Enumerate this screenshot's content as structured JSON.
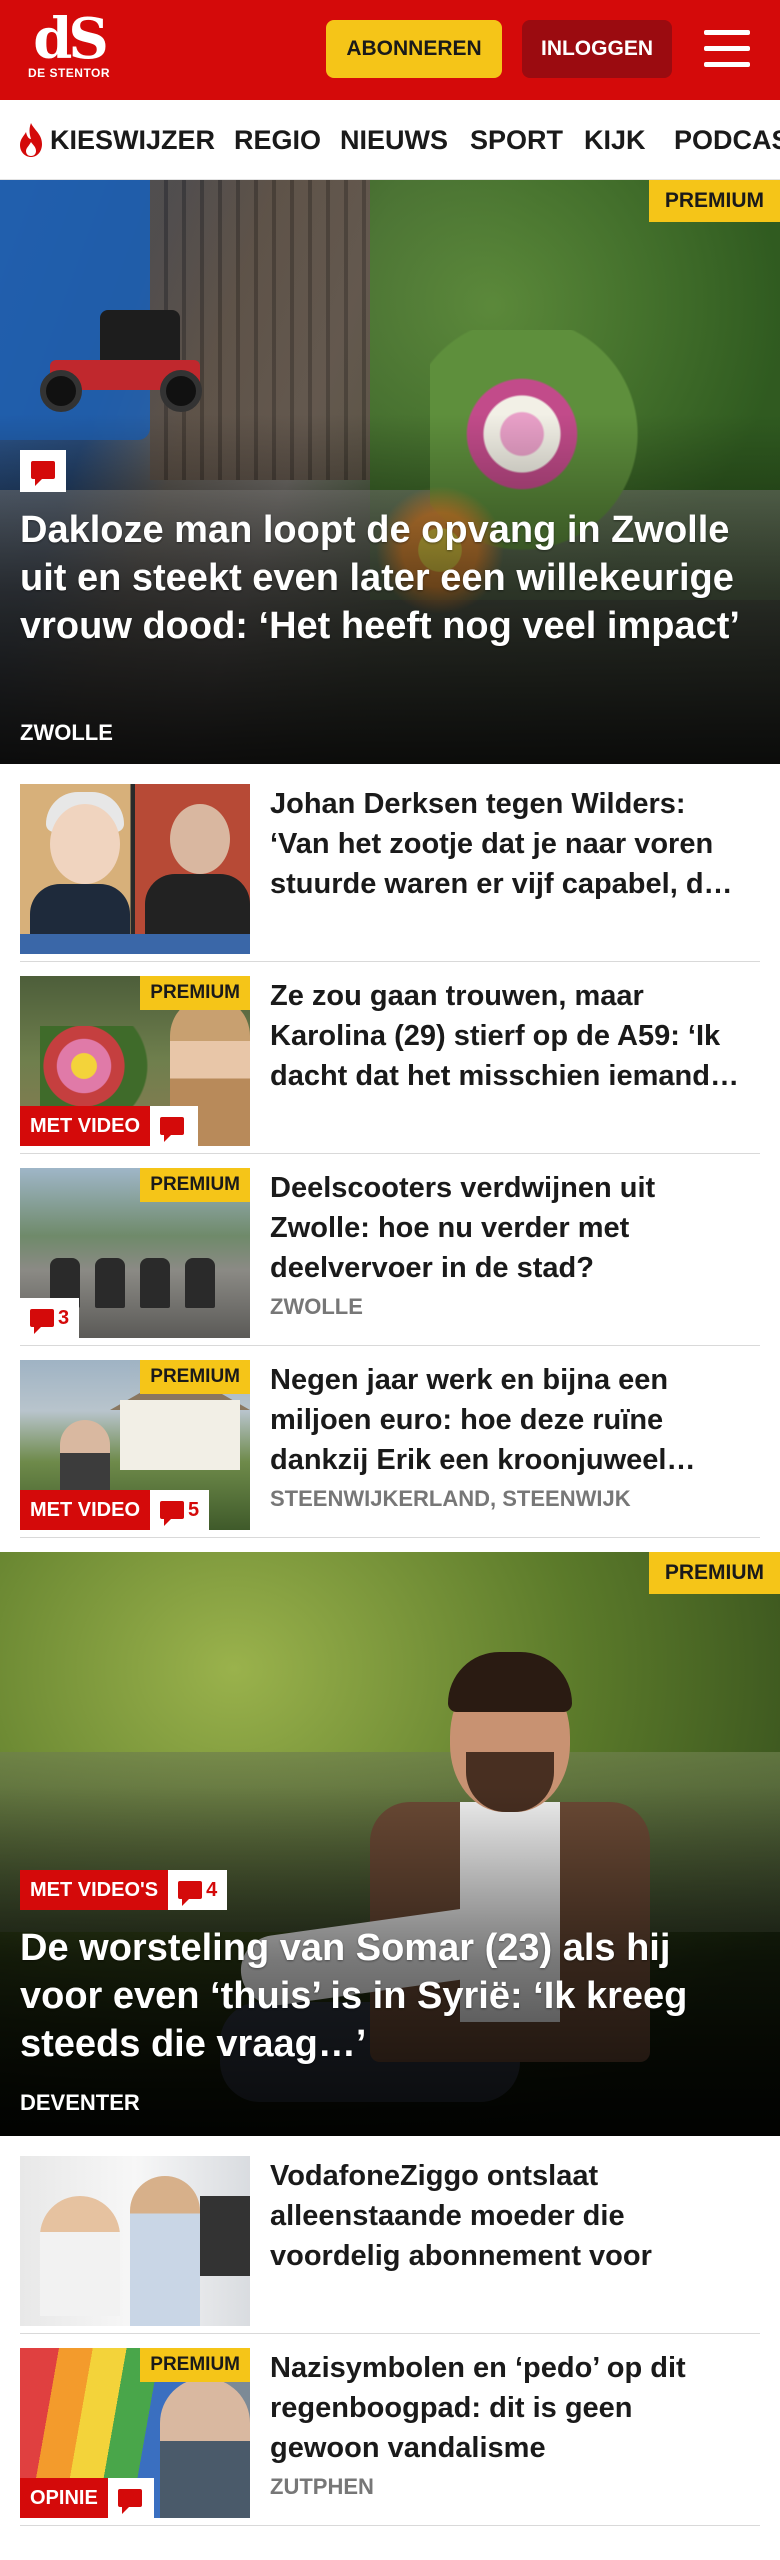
{
  "header": {
    "logo_mark": "dS",
    "logo_text": "DE STENTOR",
    "subscribe_label": "ABONNEREN",
    "login_label": "INLOGGEN",
    "colors": {
      "brand_red": "#d40a0a",
      "accent_yellow": "#f5c518",
      "login_dark_red": "#9b0b10"
    }
  },
  "nav": {
    "items": [
      {
        "label": "KIESWIJZER",
        "icon": "flame-icon"
      },
      {
        "label": "REGIO"
      },
      {
        "label": "NIEUWS"
      },
      {
        "label": "SPORT"
      },
      {
        "label": "KIJK"
      },
      {
        "label": "PODCAS"
      }
    ]
  },
  "hero1": {
    "badge": "PREMIUM",
    "title": "Dakloze man loopt de opvang in Zwolle uit en steekt even later een willekeurige vrouw dood: ‘Het heeft nog veel impact’",
    "location": "ZWOLLE"
  },
  "articles": [
    {
      "title": "Johan Derksen tegen Wilders: ‘Van het zootje dat je naar voren stuurde waren er vijf capabel, d…",
      "location": "",
      "premium": "",
      "video": "",
      "comments": ""
    },
    {
      "title": "Ze zou gaan trouwen, maar Karolina (29) stierf op de A59: ‘Ik dacht dat het misschien iemand…",
      "location": "",
      "premium": "PREMIUM",
      "video": "MET VIDEO",
      "comments": ""
    },
    {
      "title": "Deelscooters verdwijnen uit Zwolle: hoe nu verder met deelvervoer in de stad?",
      "location": "ZWOLLE",
      "premium": "PREMIUM",
      "video": "",
      "comments": "3"
    },
    {
      "title": "Negen jaar werk en bijna een miljoen euro: hoe deze ruïne dankzij Erik een kroonjuweel…",
      "location": "STEENWIJKERLAND, STEENWIJK",
      "premium": "PREMIUM",
      "video": "MET VIDEO",
      "comments": "5"
    }
  ],
  "hero2": {
    "badge": "PREMIUM",
    "video": "MET VIDEO'S",
    "comments": "4",
    "title": "De worsteling van Somar (23) als hij voor even ‘thuis’ is in Syrië: ‘Ik kreeg steeds die vraag…’",
    "location": "DEVENTER"
  },
  "articles2": [
    {
      "title": "VodafoneZiggo ontslaat alleenstaande moeder die voordelig abonnement voor kinderen wil…",
      "location": "",
      "premium": ""
    },
    {
      "title": "Nazisymbolen en ‘pedo’ op dit regenboogpad: dit is geen gewoon vandalisme",
      "location": "ZUTPHEN",
      "premium": "PREMIUM",
      "label": "OPINIE"
    }
  ]
}
